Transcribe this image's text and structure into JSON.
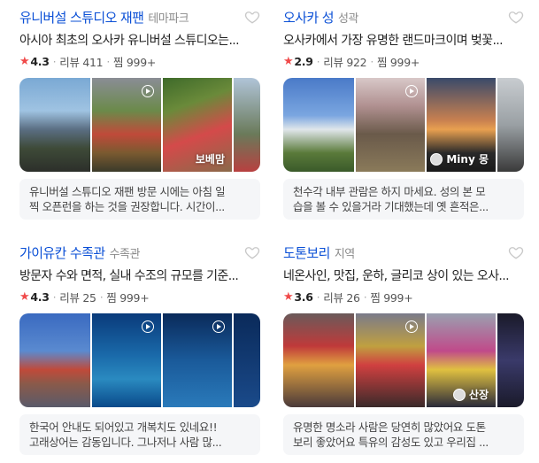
{
  "cards": [
    {
      "name": "유니버설 스튜디오 재팬",
      "category": "테마파크",
      "description": "아시아 최초의 오사카 유니버설 스튜디오는...",
      "rating": "4.3",
      "reviews": "리뷰 411",
      "saves": "찜 999+",
      "photo_overlay": "보베맘",
      "review_lines": [
        "유니버설 스튜디오 재팬 방문 시에는 아침 일",
        "찍 오픈런을 하는 것을 권장합니다. 시간이..."
      ]
    },
    {
      "name": "오사카 성",
      "category": "성곽",
      "description": "오사카에서 가장 유명한 랜드마크이며 벚꽃...",
      "rating": "2.9",
      "reviews": "리뷰 922",
      "saves": "찜 999+",
      "photo_overlay": "Miny 몽",
      "review_lines": [
        "천수각 내부 관람은 하지 마세요. 성의 본 모",
        "습을 볼 수 있을거라 기대했는데 옛 흔적은..."
      ]
    },
    {
      "name": "가이유칸 수족관",
      "category": "수족관",
      "description": "방문자 수와 면적, 실내 수조의 규모를 기준...",
      "rating": "4.3",
      "reviews": "리뷰 25",
      "saves": "찜 999+",
      "photo_overlay": "",
      "review_lines": [
        "한국어 안내도 되어있고 개복치도 있네요!!",
        "고래상어는 감동입니다. 그나저나 사람 많..."
      ]
    },
    {
      "name": "도톤보리",
      "category": "지역",
      "description": "네온사인, 맛집, 운하, 글리코 상이 있는 오사...",
      "rating": "3.6",
      "reviews": "리뷰 26",
      "saves": "찜 999+",
      "photo_overlay": "산장",
      "review_lines": [
        "유명한 명소라 사람은 당연히 많았어요 도톤",
        "보리 좋았어요 특유의 감성도 있고 우리집 ..."
      ]
    }
  ],
  "colors": {
    "link": "#0a4fd6",
    "star": "#f04a4a"
  },
  "icons": {
    "heart": "heart-outline-icon",
    "play": "play-icon",
    "star": "star-icon"
  }
}
